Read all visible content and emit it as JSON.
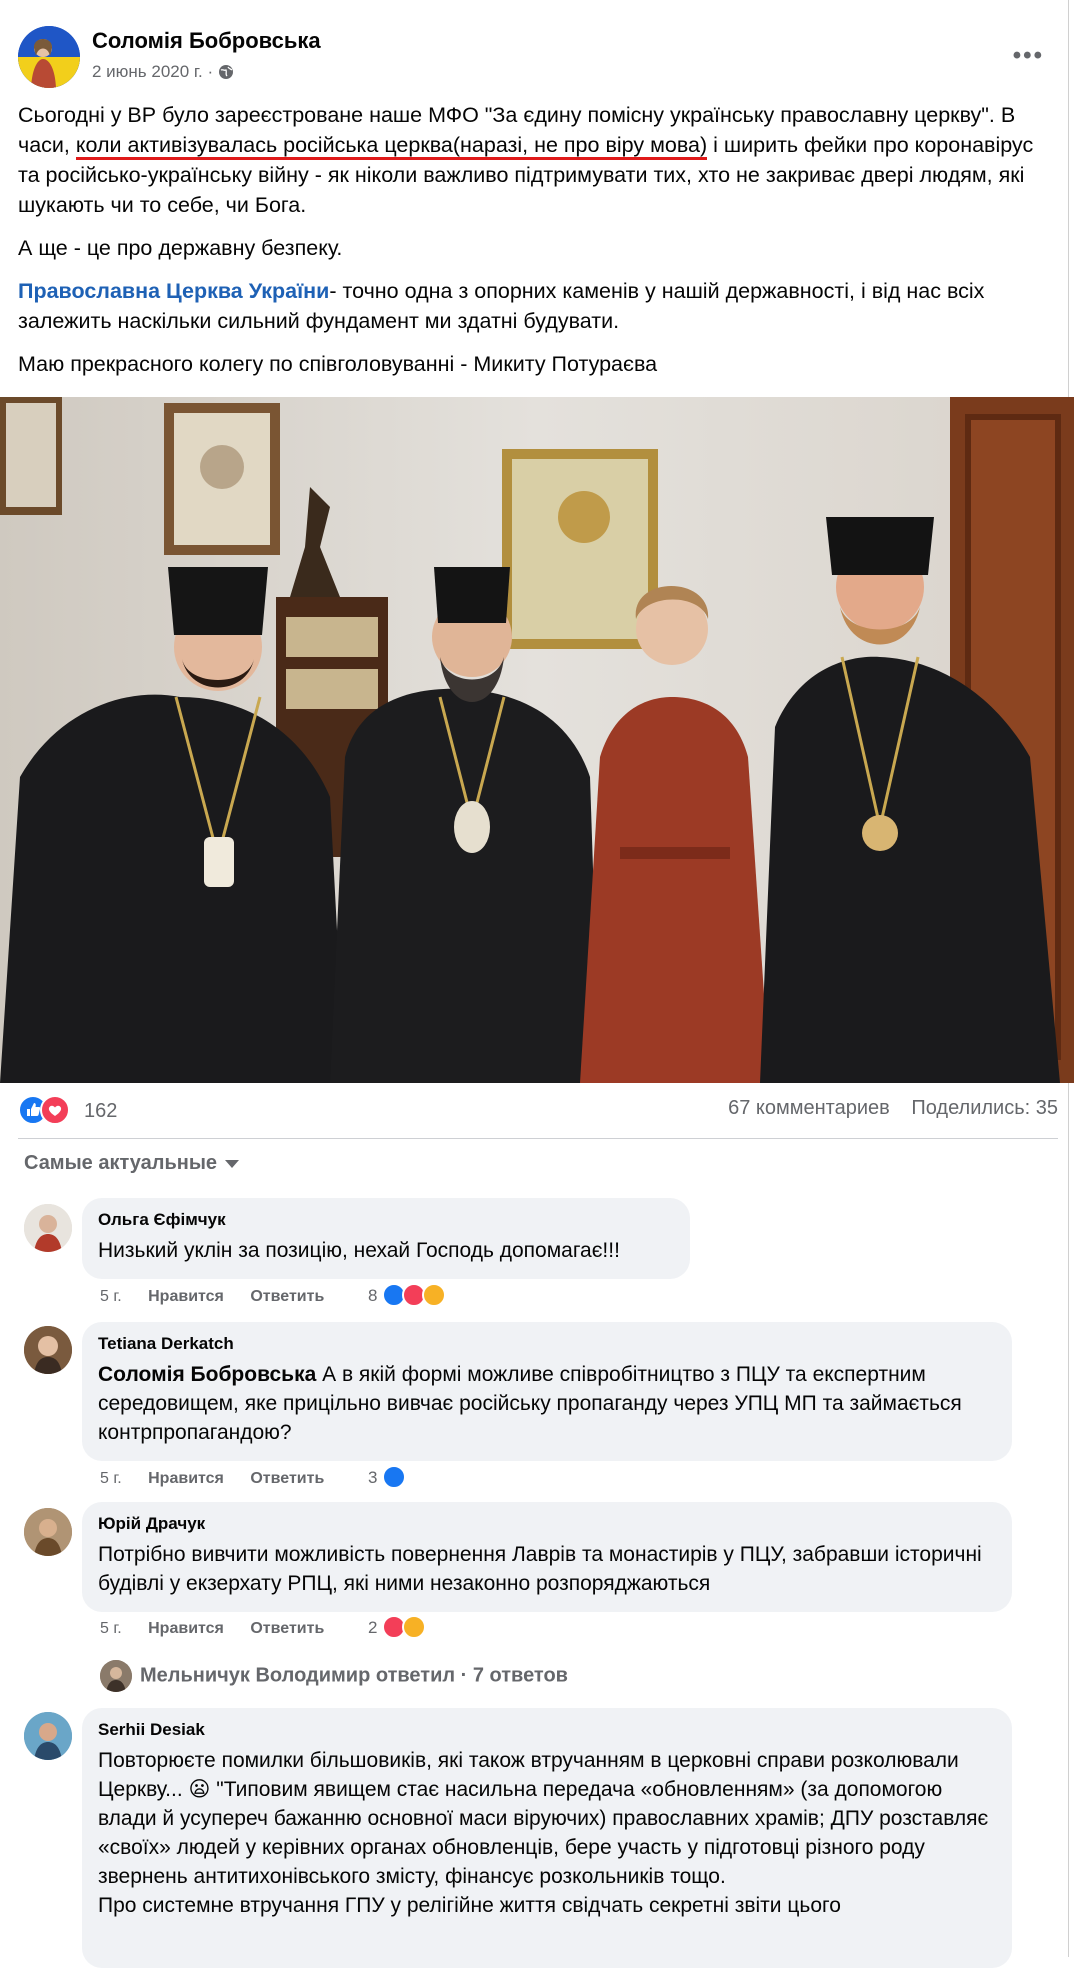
{
  "post": {
    "author": "Соломія Бобровська",
    "date": "2 июнь 2020 г.",
    "globe_icon": "globe-icon",
    "more": "•••",
    "para1_a": "Сьогодні у ВР було зареєстроване наше МФО \"За єдину помісну українську православну церкву\". В часи, ",
    "para1_underlined": "коли активізувалась російська церква(наразі, не про віру мова)",
    "para1_b": " і ширить фейки про коронавірус та російсько-українську війну - як ніколи важливо підтримувати тих, хто  не закриває двері людям, які шукають чи то себе, чи Бога.",
    "para2": "А ще - це про державну безпеку.",
    "para3_link": "Православна Церква України",
    "para3_rest": "- точно одна з опорних каменів у нашій державності, і від нас всіх залежить наскільки сильний фундамент ми здатні будувати.",
    "para4": "Маю прекрасного колегу по співголовуванні - Микиту Потураєва"
  },
  "stats": {
    "reactions_count": "162",
    "comments": "67 комментариев",
    "shares": "Поделились: 35",
    "reaction_icons": [
      "like-icon",
      "love-icon"
    ]
  },
  "sort_label": "Самые актуальные",
  "comments": [
    {
      "name": "Ольга Єфімчук",
      "text": "Низький уклін за позицію, нехай Господь допомагає!!!",
      "time": "5 г.",
      "like": "Нравится",
      "reply": "Ответить",
      "count": "8"
    },
    {
      "name": "Tetiana Derkatch",
      "mention": "Соломія Бобровська",
      "text": " А в якій формі можливе співробітництво з ПЦУ та експертним середовищем, яке прицільно вивчає російську пропаганду через УПЦ МП та займається контрпропагандою?",
      "time": "5 г.",
      "like": "Нравится",
      "reply": "Ответить",
      "count": "3"
    },
    {
      "name": "Юрій Драчук",
      "text": "Потрібно вивчити можливість повернення Лаврів та монастирів у ПЦУ, забравши історичні будівлі у екзерхату РПЦ, які ними незаконно розпоряджаються",
      "time": "5 г.",
      "like": "Нравится",
      "reply": "Ответить",
      "count": "2"
    },
    {
      "name": "Serhii Desiak",
      "text": "Повторюєте помилки більшовиків, які також втручанням в церковні справи розколювали Церкву... 😦 \"Типовим явищем стає насильна передача «обновленням» (за допомогою влади й усупереч бажанню основної маси віруючих) православних храмів; ДПУ розставляє «своїх» людей у керівних органах обновленців, бере участь у підготовці різного роду звернень антитихонівського змісту, фінансує розкольників тощо.",
      "text2": "Про системне втручання ГПУ у релігійне життя свідчать секретні звіти цього"
    }
  ],
  "reply_summary": "Мельничук Володимир ответил · 7 ответов",
  "colors": {
    "link": "#1e61b5",
    "underline": "#e01a1a",
    "bubble": "#f0f2f5",
    "muted": "#65676b",
    "like": "#1877f2",
    "love": "#f33e58",
    "haha": "#f7b125"
  }
}
